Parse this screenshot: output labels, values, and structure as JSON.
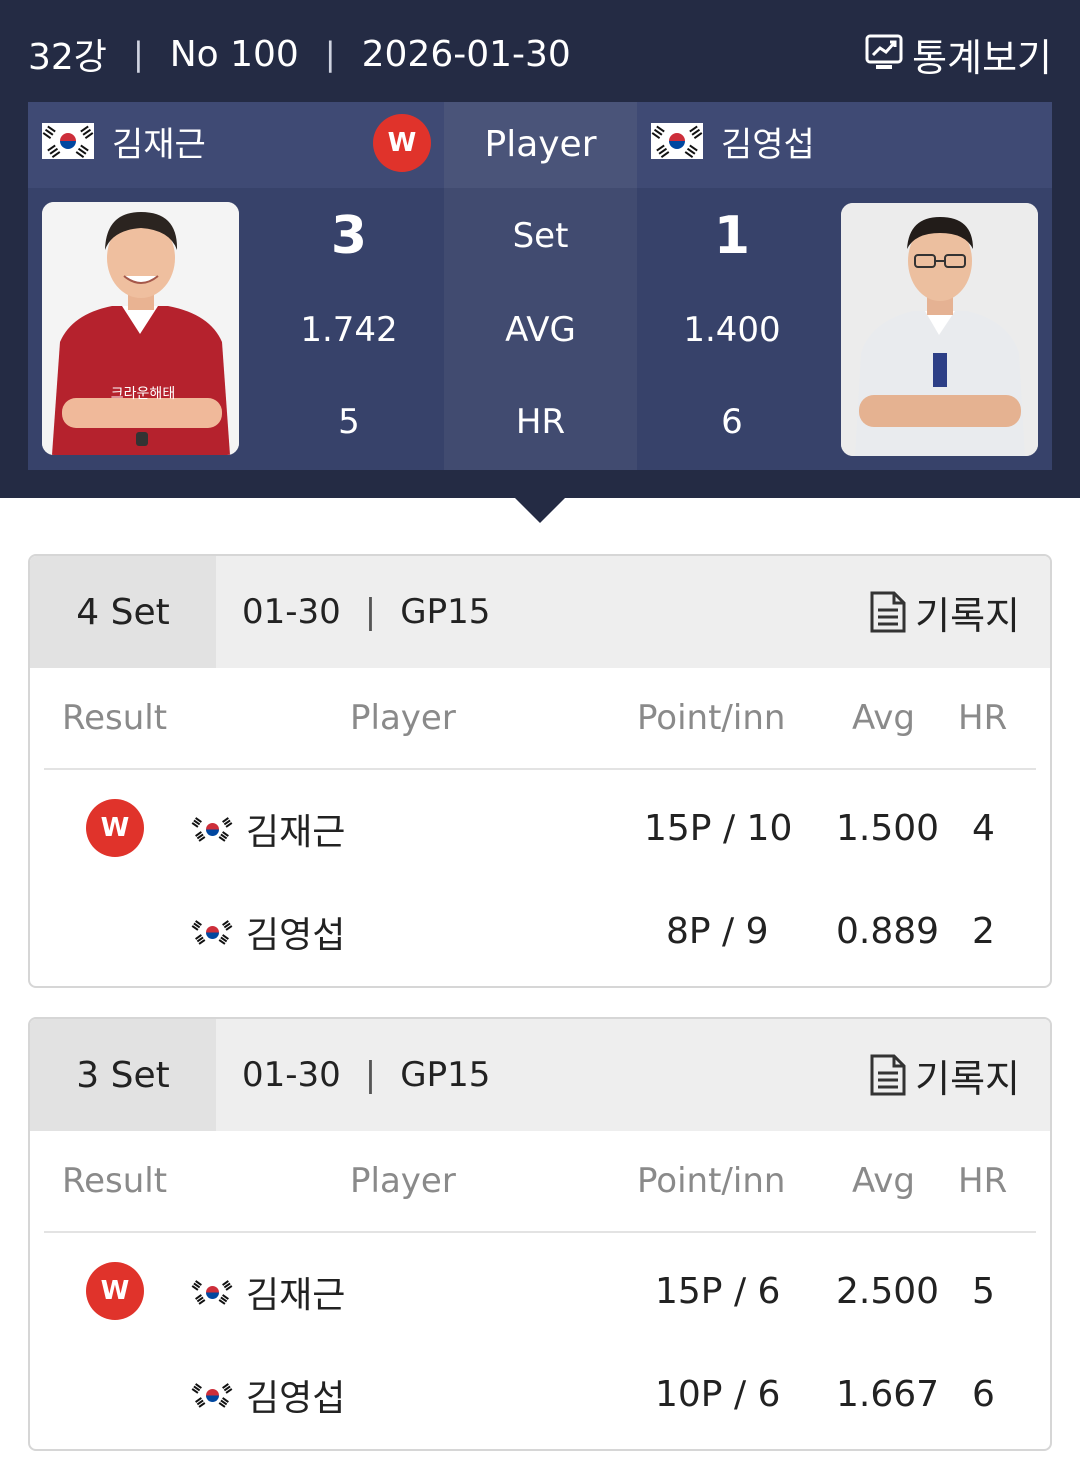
{
  "header": {
    "round": "32강",
    "match_no": "No 100",
    "date": "2026-01-30",
    "stats_label": "통계보기",
    "separator": "|"
  },
  "scoreboard": {
    "player_label": "Player",
    "left_player": {
      "name": "김재근",
      "winner_badge": "W",
      "set": "3",
      "avg": "1.742",
      "hr": "5",
      "photo_text": "크라운해태"
    },
    "right_player": {
      "name": "김영섭",
      "set": "1",
      "avg": "1.400",
      "hr": "6"
    },
    "rows": {
      "set": "Set",
      "avg": "AVG",
      "hr": "HR"
    }
  },
  "table_headers": {
    "result": "Result",
    "player": "Player",
    "points": "Point/inn",
    "avg": "Avg",
    "hr": "HR"
  },
  "sets": [
    {
      "label": "4 Set",
      "date": "01-30",
      "separator": "|",
      "venue": "GP15",
      "record_label": "기록지",
      "rows": [
        {
          "result": "W",
          "name": "김재근",
          "points": "15P / 10",
          "avg": "1.500",
          "hr": "4"
        },
        {
          "result": "",
          "name": "김영섭",
          "points": "8P / 9",
          "avg": "0.889",
          "hr": "2"
        }
      ]
    },
    {
      "label": "3 Set",
      "date": "01-30",
      "separator": "|",
      "venue": "GP15",
      "record_label": "기록지",
      "rows": [
        {
          "result": "W",
          "name": "김재근",
          "points": "15P / 6",
          "avg": "2.500",
          "hr": "5"
        },
        {
          "result": "",
          "name": "김영섭",
          "points": "10P / 6",
          "avg": "1.667",
          "hr": "6"
        }
      ]
    }
  ],
  "colors": {
    "panel_bg": "#242b44",
    "board_bg": "#37426a",
    "win_badge": "#e0332b",
    "card_head": "#eeeeee"
  },
  "icons": {
    "stats": "chart-line-icon",
    "record": "document-icon",
    "flag": "korea-flag-icon"
  }
}
